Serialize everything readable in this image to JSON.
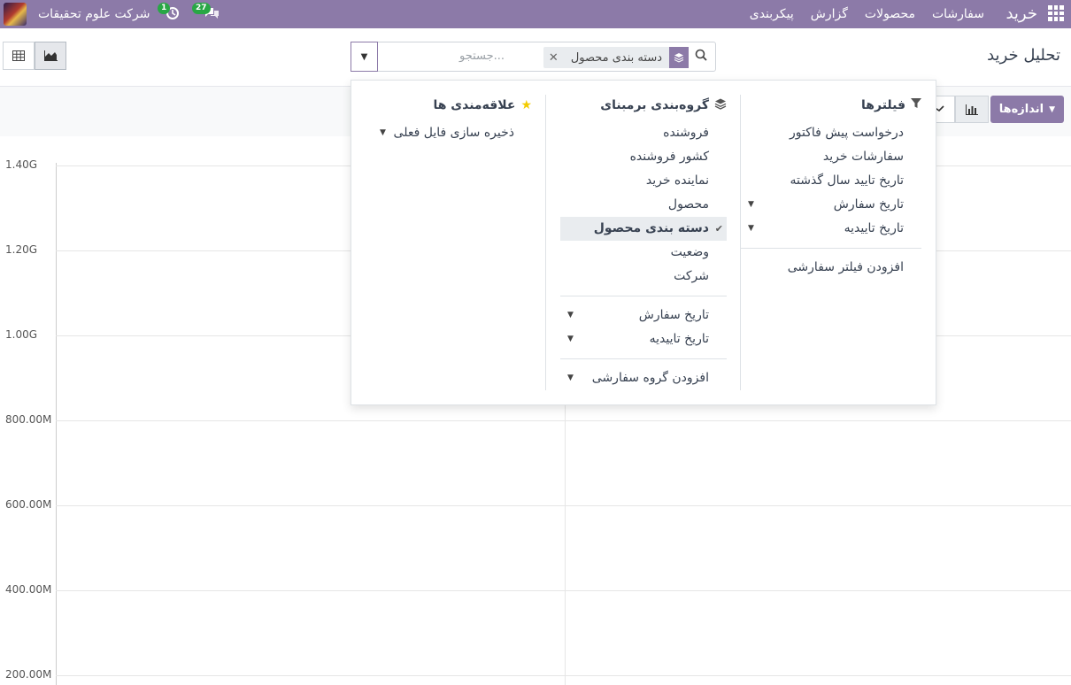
{
  "topbar": {
    "brand": "خرید",
    "menu": [
      "سفارشات",
      "محصولات",
      "گزارش",
      "پیکربندی"
    ],
    "company": "شرکت علوم تحقیقات",
    "messages_count": "27",
    "activity_count": "1"
  },
  "control": {
    "title": "تحلیل خرید",
    "search_placeholder": "جستجو...",
    "facet_value": "دسته بندی محصول",
    "facet_close": "✕"
  },
  "graph": {
    "measures_label": "اندازه‌ها"
  },
  "dropdown": {
    "filters": {
      "heading": "فیلترها",
      "items": [
        {
          "label": "درخواست پیش فاکتور",
          "caret": ""
        },
        {
          "label": "سفارشات خرید",
          "caret": ""
        },
        {
          "label": "تاریخ تایید سال گذشته",
          "caret": ""
        },
        {
          "label": "تاریخ سفارش",
          "caret": "▼"
        },
        {
          "label": "تاریخ تاییدیه",
          "caret": "▼"
        }
      ],
      "custom": "افزودن فیلتر سفارشی"
    },
    "groupby": {
      "heading": "گروه‌بندی برمبنای",
      "items": [
        {
          "label": "فروشنده"
        },
        {
          "label": "کشور فروشنده"
        },
        {
          "label": "نماینده خرید"
        },
        {
          "label": "محصول"
        },
        {
          "label": "دسته بندی محصول",
          "selected": true
        },
        {
          "label": "وضعیت"
        },
        {
          "label": "شرکت"
        }
      ],
      "date_items": [
        {
          "label": "تاریخ سفارش",
          "caret": "▼"
        },
        {
          "label": "تاریخ تاییدیه",
          "caret": "▼"
        }
      ],
      "custom": "افزودن گروه سفارشی"
    },
    "favorites": {
      "heading": "علاقه‌مندی ها",
      "save": "ذخیره سازی فایل فعلی"
    }
  },
  "chart_data": {
    "type": "line",
    "y_ticks": [
      "1.40G",
      "1.20G",
      "1.00G",
      "800.00M",
      "600.00M",
      "400.00M",
      "200.00M"
    ],
    "y_values": [
      1400000000,
      1200000000,
      1000000000,
      800000000,
      600000000,
      400000000,
      200000000
    ],
    "grid": true
  }
}
